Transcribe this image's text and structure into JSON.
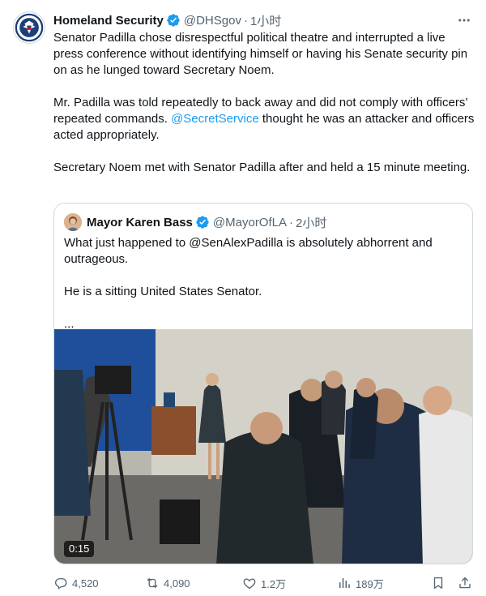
{
  "tweet": {
    "author": {
      "name": "Homeland Security",
      "handle": "@DHSgov",
      "separator": "·",
      "time": "1小时",
      "avatar_icon": "dhs-seal-icon",
      "verified_icon": "verified-badge-icon"
    },
    "more_icon": "more-options-icon",
    "paragraphs": [
      "Senator Padilla chose disrespectful political theatre and interrupted a live press conference without identifying himself or having his Senate security pin on as he lunged toward Secretary Noem."
    ],
    "paragraph2": {
      "before": "Mr. Padilla was told repeatedly to back away and did not comply with officers’ repeated commands. ",
      "mention": "@SecretService",
      "after": " thought he was an attacker and officers acted appropriately."
    },
    "paragraph3": "Secretary Noem met with Senator Padilla after and held a 15 minute meeting.",
    "quote": {
      "author": {
        "name": "Mayor Karen Bass",
        "handle": "@MayorOfLA",
        "separator": "·",
        "time": "2小时",
        "verified_icon": "verified-badge-icon"
      },
      "paragraphs": [
        "What just happened to @SenAlexPadilla is absolutely abhorrent and outrageous.",
        "He is a sitting United States Senator."
      ],
      "ellipsis": "...",
      "video": {
        "duration": "0:15",
        "description_icon": "video-thumbnail"
      }
    },
    "actions": {
      "reply": {
        "icon": "reply-icon",
        "count": "4,520"
      },
      "retweet": {
        "icon": "retweet-icon",
        "count": "4,090"
      },
      "like": {
        "icon": "like-icon",
        "count": "1.2万"
      },
      "views": {
        "icon": "views-icon",
        "count": "189万"
      },
      "bookmark": {
        "icon": "bookmark-icon"
      },
      "share": {
        "icon": "share-icon"
      }
    },
    "colors": {
      "text": "#0f1419",
      "secondary": "#536471",
      "accent": "#1d9bf0",
      "border": "#cfd9de"
    }
  }
}
